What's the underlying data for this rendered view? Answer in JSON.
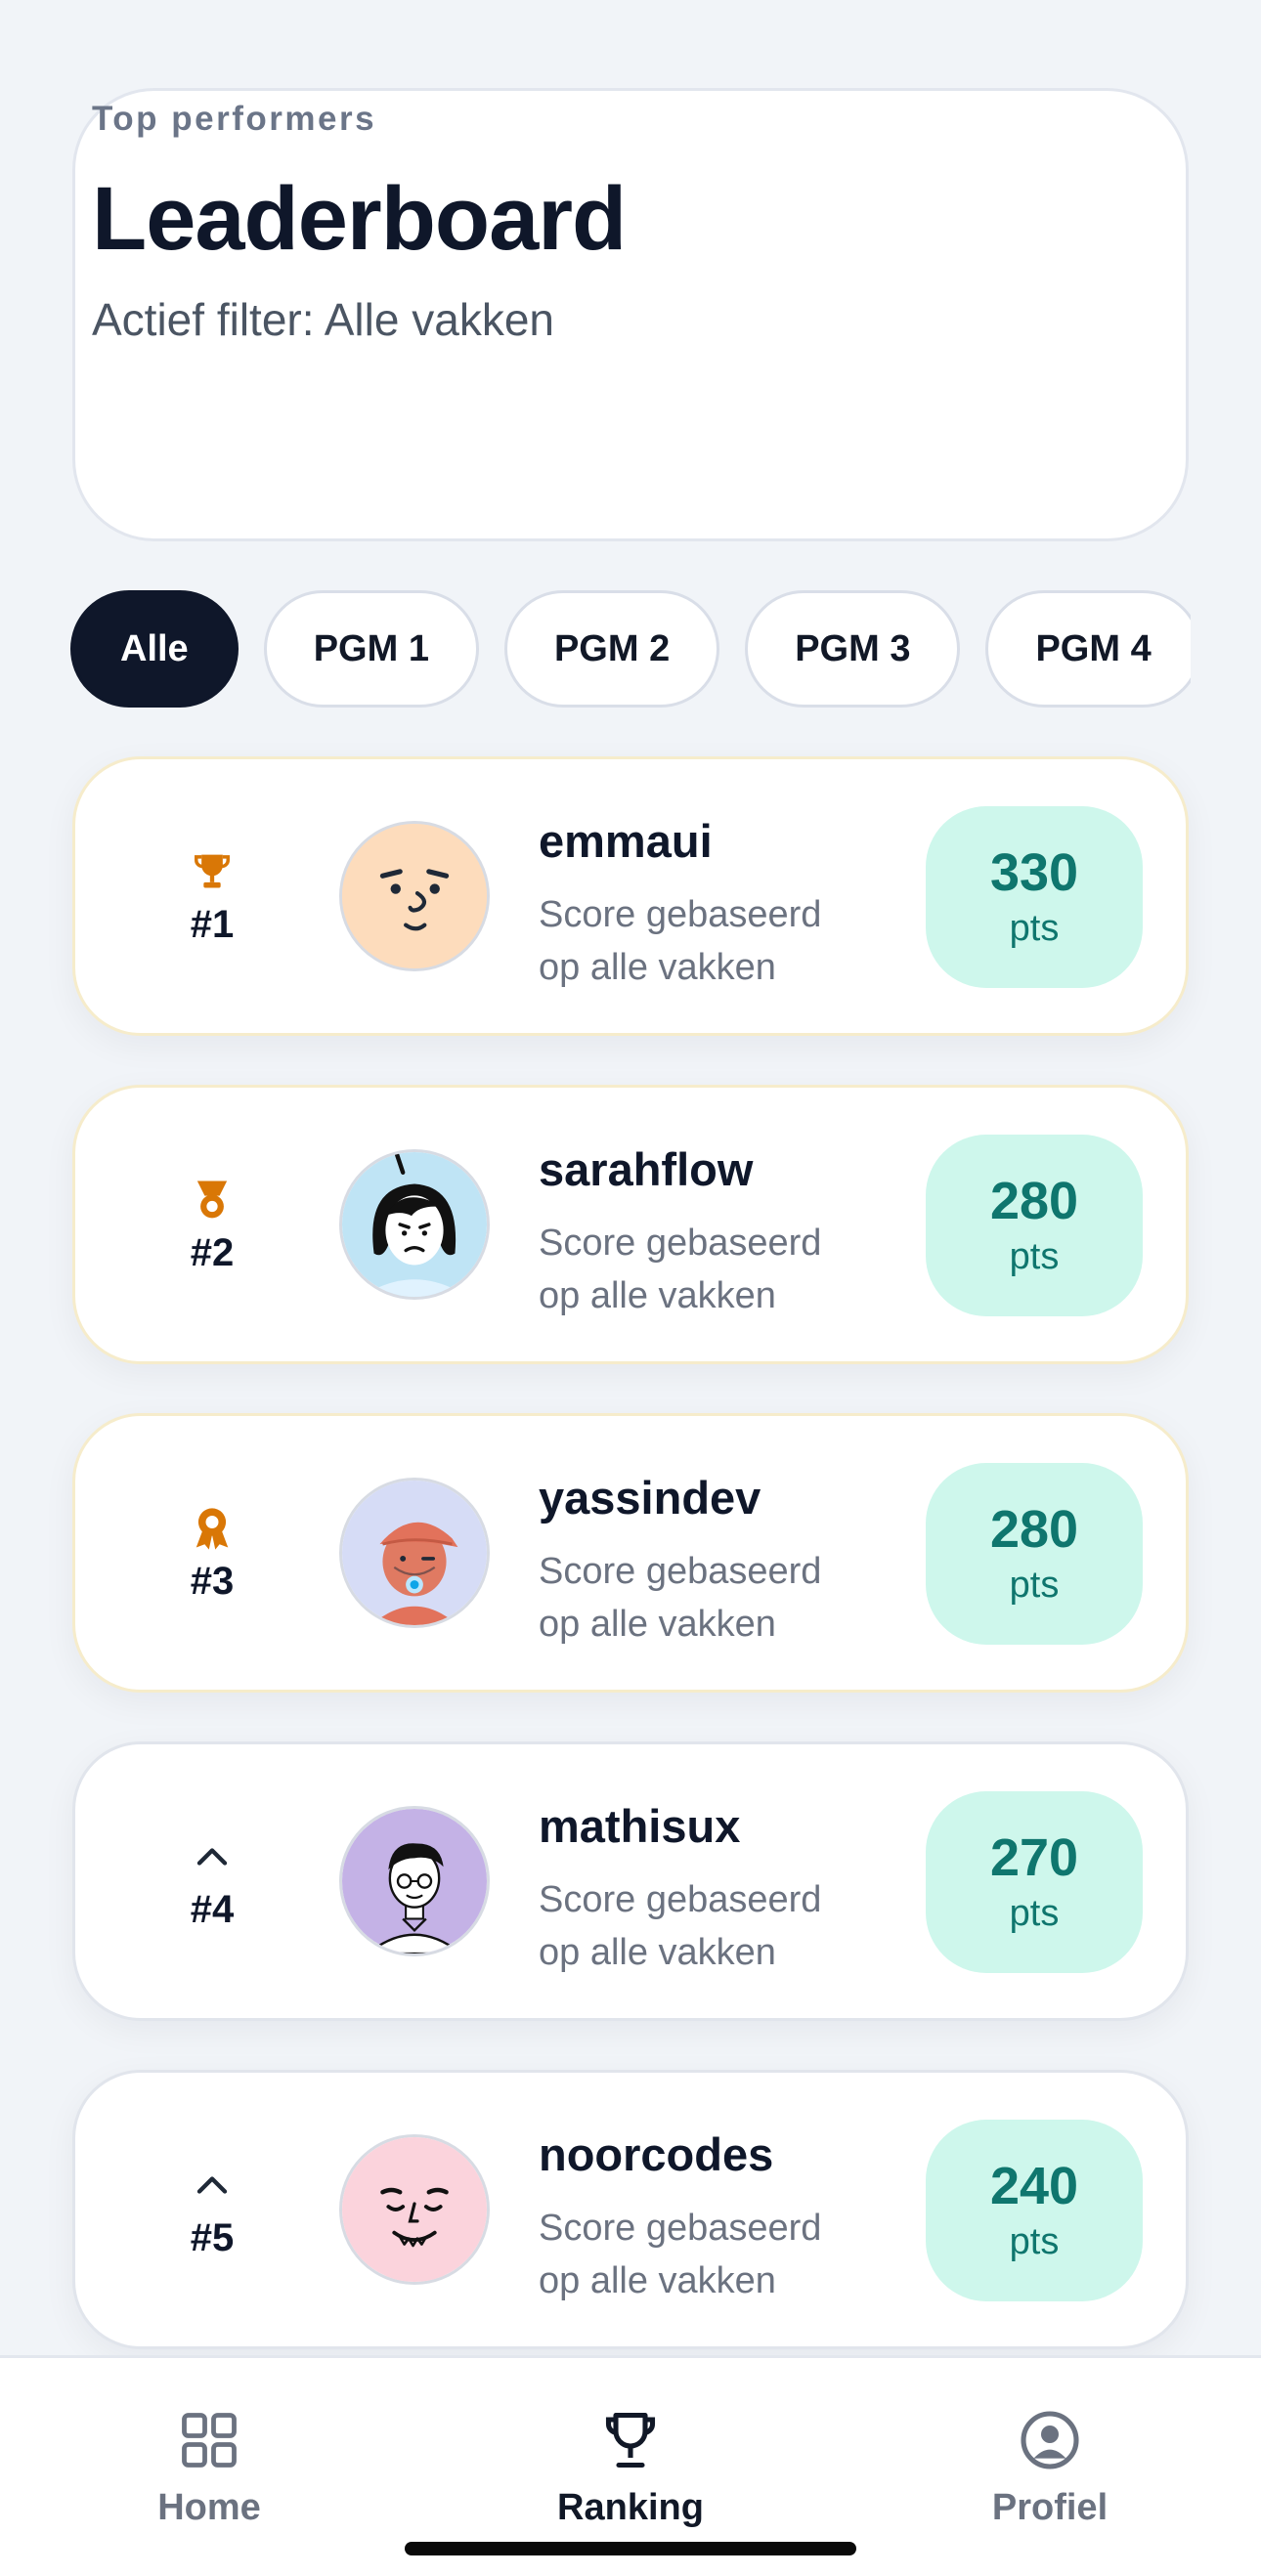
{
  "header": {
    "eyebrow": "Top performers",
    "title": "Leaderboard",
    "filter_text": "Actief filter: Alle vakken"
  },
  "filters": [
    {
      "label": "Alle",
      "active": true
    },
    {
      "label": "PGM 1",
      "active": false
    },
    {
      "label": "PGM 2",
      "active": false
    },
    {
      "label": "PGM 3",
      "active": false
    },
    {
      "label": "PGM 4",
      "active": false
    }
  ],
  "rows": [
    {
      "rank": "#1",
      "icon": "trophy-icon",
      "name": "emmaui",
      "subtitle": "Score gebaseerd op alle vakken",
      "score": "330",
      "unit": "pts"
    },
    {
      "rank": "#2",
      "icon": "medal-icon",
      "name": "sarahflow",
      "subtitle": "Score gebaseerd op alle vakken",
      "score": "280",
      "unit": "pts"
    },
    {
      "rank": "#3",
      "icon": "award-ribbon-icon",
      "name": "yassindev",
      "subtitle": "Score gebaseerd op alle vakken",
      "score": "280",
      "unit": "pts"
    },
    {
      "rank": "#4",
      "icon": "chevron-up-icon",
      "name": "mathisux",
      "subtitle": "Score gebaseerd op alle vakken",
      "score": "270",
      "unit": "pts"
    },
    {
      "rank": "#5",
      "icon": "chevron-up-icon",
      "name": "noorcodes",
      "subtitle": "Score gebaseerd op alle vakken",
      "score": "240",
      "unit": "pts"
    }
  ],
  "nav": {
    "home": "Home",
    "ranking": "Ranking",
    "profile": "Profiel",
    "active": "ranking"
  },
  "colors": {
    "accent_dark": "#0f172a",
    "score_bg": "#cef7ec",
    "score_text": "#0f766e",
    "podium_icon": "#d97706"
  }
}
